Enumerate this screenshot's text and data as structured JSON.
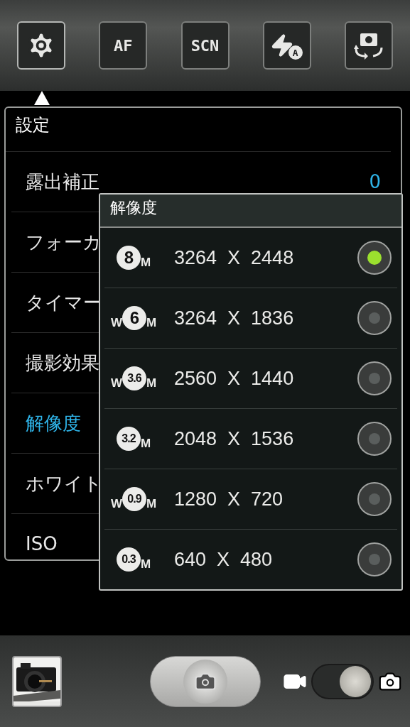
{
  "toolbar": [
    {
      "kind": "settings",
      "selected": true
    },
    {
      "kind": "text",
      "label": "AF",
      "selected": false
    },
    {
      "kind": "text",
      "label": "SCN",
      "selected": false
    },
    {
      "kind": "flash",
      "badge": "A",
      "selected": false
    },
    {
      "kind": "switch-camera",
      "selected": false
    }
  ],
  "settings": {
    "title": "設定",
    "items": [
      {
        "label": "露出補正",
        "value": "0",
        "selected": false
      },
      {
        "label": "フォーカ",
        "selected": false
      },
      {
        "label": "タイマー",
        "selected": false
      },
      {
        "label": "撮影効果",
        "selected": false
      },
      {
        "label": "解像度",
        "selected": true
      },
      {
        "label": "ホワイト",
        "selected": false
      },
      {
        "label": "ISO",
        "selected": false
      }
    ]
  },
  "resolution_popup": {
    "title": "解像度",
    "options": [
      {
        "size": "8",
        "unit": "M",
        "label": "3264  X  2448",
        "selected": true
      },
      {
        "prefix": "W",
        "size": "6",
        "unit": "M",
        "label": "3264  X  1836",
        "selected": false
      },
      {
        "prefix": "W",
        "size": "3.6",
        "unit": "M",
        "label": "2560  X  1440",
        "selected": false
      },
      {
        "size": "3.2",
        "unit": "M",
        "label": "2048  X  1536",
        "selected": false
      },
      {
        "prefix": "W",
        "size": "0.9",
        "unit": "M",
        "label": "1280  X  720",
        "selected": false
      },
      {
        "size": "0.3",
        "unit": "M",
        "label": "640  X  480",
        "selected": false
      }
    ]
  },
  "bottom_bar": {
    "photo_mode": true
  }
}
